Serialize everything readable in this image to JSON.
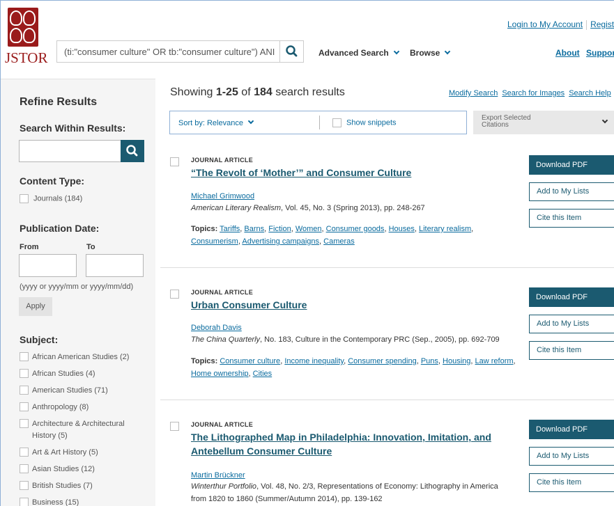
{
  "brand": {
    "logo_text": "JSTOR",
    "accent": "#9a1b1b",
    "primary": "#1b5a70",
    "link": "#0a6b9e"
  },
  "header": {
    "search_value": "(ti:\"consumer culture\" OR tb:\"consumer culture\") ANI",
    "search_icon": "search-icon",
    "nav": {
      "advanced": "Advanced Search",
      "browse": "Browse"
    },
    "top_links": {
      "login": "Login to My Account",
      "register": "Registe"
    },
    "about": "About",
    "support": "Suppor"
  },
  "sidebar": {
    "title": "Refine Results",
    "search_within": "Search Within Results:",
    "content_type": {
      "heading": "Content Type:",
      "items": [
        {
          "label": "Journals (184)"
        }
      ]
    },
    "pub_date": {
      "heading": "Publication Date:",
      "from": "From",
      "to": "To",
      "hint": "(yyyy or yyyy/mm or yyyy/mm/dd)",
      "apply": "Apply"
    },
    "subject": {
      "heading": "Subject:",
      "items": [
        {
          "label": "African American Studies (2)"
        },
        {
          "label": "African Studies (4)"
        },
        {
          "label": "American Studies (71)"
        },
        {
          "label": "Anthropology (8)"
        },
        {
          "label": "Architecture & Architectural History (5)"
        },
        {
          "label": "Art & Art History (5)"
        },
        {
          "label": "Asian Studies (12)"
        },
        {
          "label": "British Studies (7)"
        },
        {
          "label": "Business (15)"
        }
      ]
    }
  },
  "main": {
    "showing": {
      "prefix": "Showing ",
      "range": "1-25",
      "of": " of ",
      "total": "184",
      "suffix": " search results"
    },
    "links": {
      "modify": "Modify Search",
      "images": "Search for Images",
      "help": "Search Help"
    },
    "sort": {
      "label": "Sort by: Relevance",
      "snippets": "Show snippets"
    },
    "export": "Export Selected Citations",
    "results": [
      {
        "type": "JOURNAL ARTICLE",
        "title": "“The Revolt of ‘Mother’” and Consumer Culture",
        "author": "Michael Grimwood",
        "journal": "American Literary Realism",
        "citation": ", Vol. 45, No. 3 (Spring 2013), pp. 248-267",
        "topics_label": "Topics:",
        "topics": [
          "Tariffs",
          "Barns",
          "Fiction",
          "Women",
          "Consumer goods",
          "Houses",
          "Literary realism",
          "Consumerism",
          "Advertising campaigns",
          "Cameras"
        ],
        "download": "Download PDF",
        "add_lists": "Add to My Lists",
        "cite": "Cite this Item"
      },
      {
        "type": "JOURNAL ARTICLE",
        "title": "Urban Consumer Culture",
        "author": "Deborah Davis",
        "journal": "The China Quarterly",
        "citation": ", No. 183, Culture in the Contemporary PRC (Sep., 2005), pp. 692-709",
        "topics_label": "Topics:",
        "topics": [
          "Consumer culture",
          "Income inequality",
          "Consumer spending",
          "Puns",
          "Housing",
          "Law reform",
          "Home ownership",
          "Cities"
        ],
        "download": "Download PDF",
        "add_lists": "Add to My Lists",
        "cite": "Cite this Item"
      },
      {
        "type": "JOURNAL ARTICLE",
        "title": "The Lithographed Map in Philadelphia: Innovation, Imitation, and Antebellum Consumer Culture",
        "author": "Martin Brückner",
        "journal": "Winterthur Portfolio",
        "citation": ", Vol. 48, No. 2/3, Representations of Economy: Lithography in America from 1820 to 1860 (Summer/Autumn 2014), pp. 139-162",
        "download": "Download PDF",
        "add_lists": "Add to My Lists",
        "cite": "Cite this Item"
      }
    ]
  }
}
